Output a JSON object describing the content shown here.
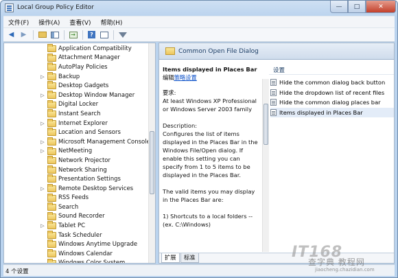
{
  "window": {
    "title": "Local Group Policy Editor"
  },
  "menu": [
    "文件(F)",
    "操作(A)",
    "查看(V)",
    "帮助(H)"
  ],
  "tree": {
    "items": [
      {
        "label": "Application Compatibility",
        "expandable": false
      },
      {
        "label": "Attachment Manager",
        "expandable": false
      },
      {
        "label": "AutoPlay Policies",
        "expandable": false
      },
      {
        "label": "Backup",
        "expandable": true
      },
      {
        "label": "Desktop Gadgets",
        "expandable": false
      },
      {
        "label": "Desktop Window Manager",
        "expandable": true
      },
      {
        "label": "Digital Locker",
        "expandable": false
      },
      {
        "label": "Instant Search",
        "expandable": false
      },
      {
        "label": "Internet Explorer",
        "expandable": true
      },
      {
        "label": "Location and Sensors",
        "expandable": false
      },
      {
        "label": "Microsoft Management Console",
        "expandable": true
      },
      {
        "label": "NetMeeting",
        "expandable": true
      },
      {
        "label": "Network Projector",
        "expandable": false
      },
      {
        "label": "Network Sharing",
        "expandable": false
      },
      {
        "label": "Presentation Settings",
        "expandable": false
      },
      {
        "label": "Remote Desktop Services",
        "expandable": true
      },
      {
        "label": "RSS Feeds",
        "expandable": false
      },
      {
        "label": "Search",
        "expandable": false
      },
      {
        "label": "Sound Recorder",
        "expandable": false
      },
      {
        "label": "Tablet PC",
        "expandable": true
      },
      {
        "label": "Task Scheduler",
        "expandable": false
      },
      {
        "label": "Windows Anytime Upgrade",
        "expandable": false
      },
      {
        "label": "Windows Calendar",
        "expandable": false
      },
      {
        "label": "Windows Color System",
        "expandable": false
      }
    ]
  },
  "details": {
    "folder_title": "Common Open File Dialog",
    "item_title": "Items displayed in Places Bar",
    "edit_prefix": "编辑",
    "edit_link": "策略设置",
    "requirements_label": "要求:",
    "requirements_text": "At least Windows XP Professional or Windows Server 2003 family",
    "description_label": "Description:",
    "description_text": "Configures the list of items displayed in the Places Bar in the Windows File/Open dialog. If enable this setting you can specify from 1 to 5 items to be displayed in the Places Bar.",
    "valid_items_text": "The valid items you may display in the Places Bar are:",
    "shortcuts_text": "1) Shortcuts to a local folders -- (ex. C:\\Windows)"
  },
  "settings": {
    "header": "设置",
    "items": [
      "Hide the common dialog back button",
      "Hide the dropdown list of recent files",
      "Hide the common dialog places bar",
      "Items displayed in Places Bar"
    ],
    "selected_index": 3
  },
  "tabs": [
    "扩展",
    "标准"
  ],
  "status": {
    "text": "4 个设置"
  },
  "watermark": {
    "logo": "IT168",
    "text": "查字典 教程网",
    "url": "jiaocheng.chazidian.com"
  }
}
